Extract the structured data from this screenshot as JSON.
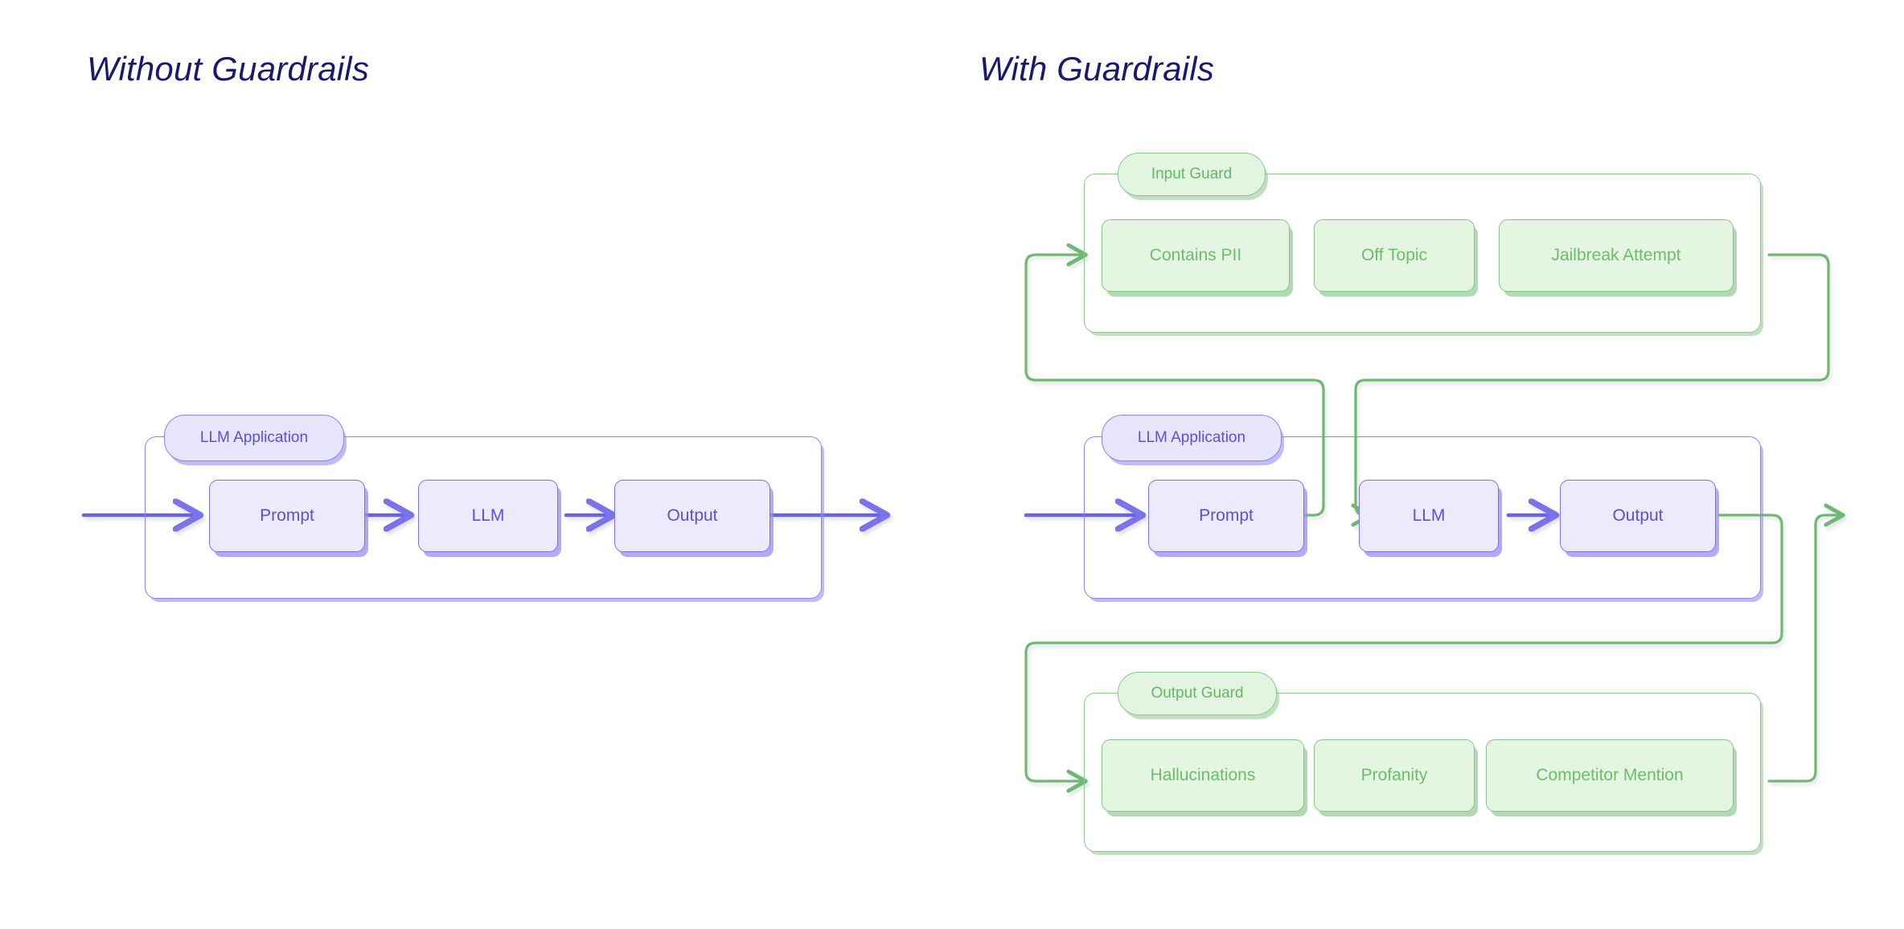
{
  "panels": {
    "left": {
      "title": "Without Guardrails"
    },
    "right": {
      "title": "With Guardrails"
    }
  },
  "colors": {
    "purple_border": "#7b72e9",
    "purple_fill": "#eceafc",
    "purple_text": "#5b51d8",
    "green_border": "#82c784",
    "green_fill": "#e4f6e2",
    "green_text": "#6bbd6b",
    "title_text": "#191970",
    "background": "#ffffff"
  },
  "left_diagram": {
    "group_label": "LLM Application",
    "nodes": [
      {
        "label": "Prompt"
      },
      {
        "label": "LLM"
      },
      {
        "label": "Output"
      }
    ]
  },
  "right_diagram": {
    "input_guard": {
      "group_label": "Input Guard",
      "nodes": [
        {
          "label": "Contains PII"
        },
        {
          "label": "Off Topic"
        },
        {
          "label": "Jailbreak Attempt"
        }
      ]
    },
    "llm_application": {
      "group_label": "LLM Application",
      "nodes": [
        {
          "label": "Prompt"
        },
        {
          "label": "LLM"
        },
        {
          "label": "Output"
        }
      ]
    },
    "output_guard": {
      "group_label": "Output Guard",
      "nodes": [
        {
          "label": "Hallucinations"
        },
        {
          "label": "Profanity"
        },
        {
          "label": "Competitor Mention"
        }
      ]
    }
  }
}
